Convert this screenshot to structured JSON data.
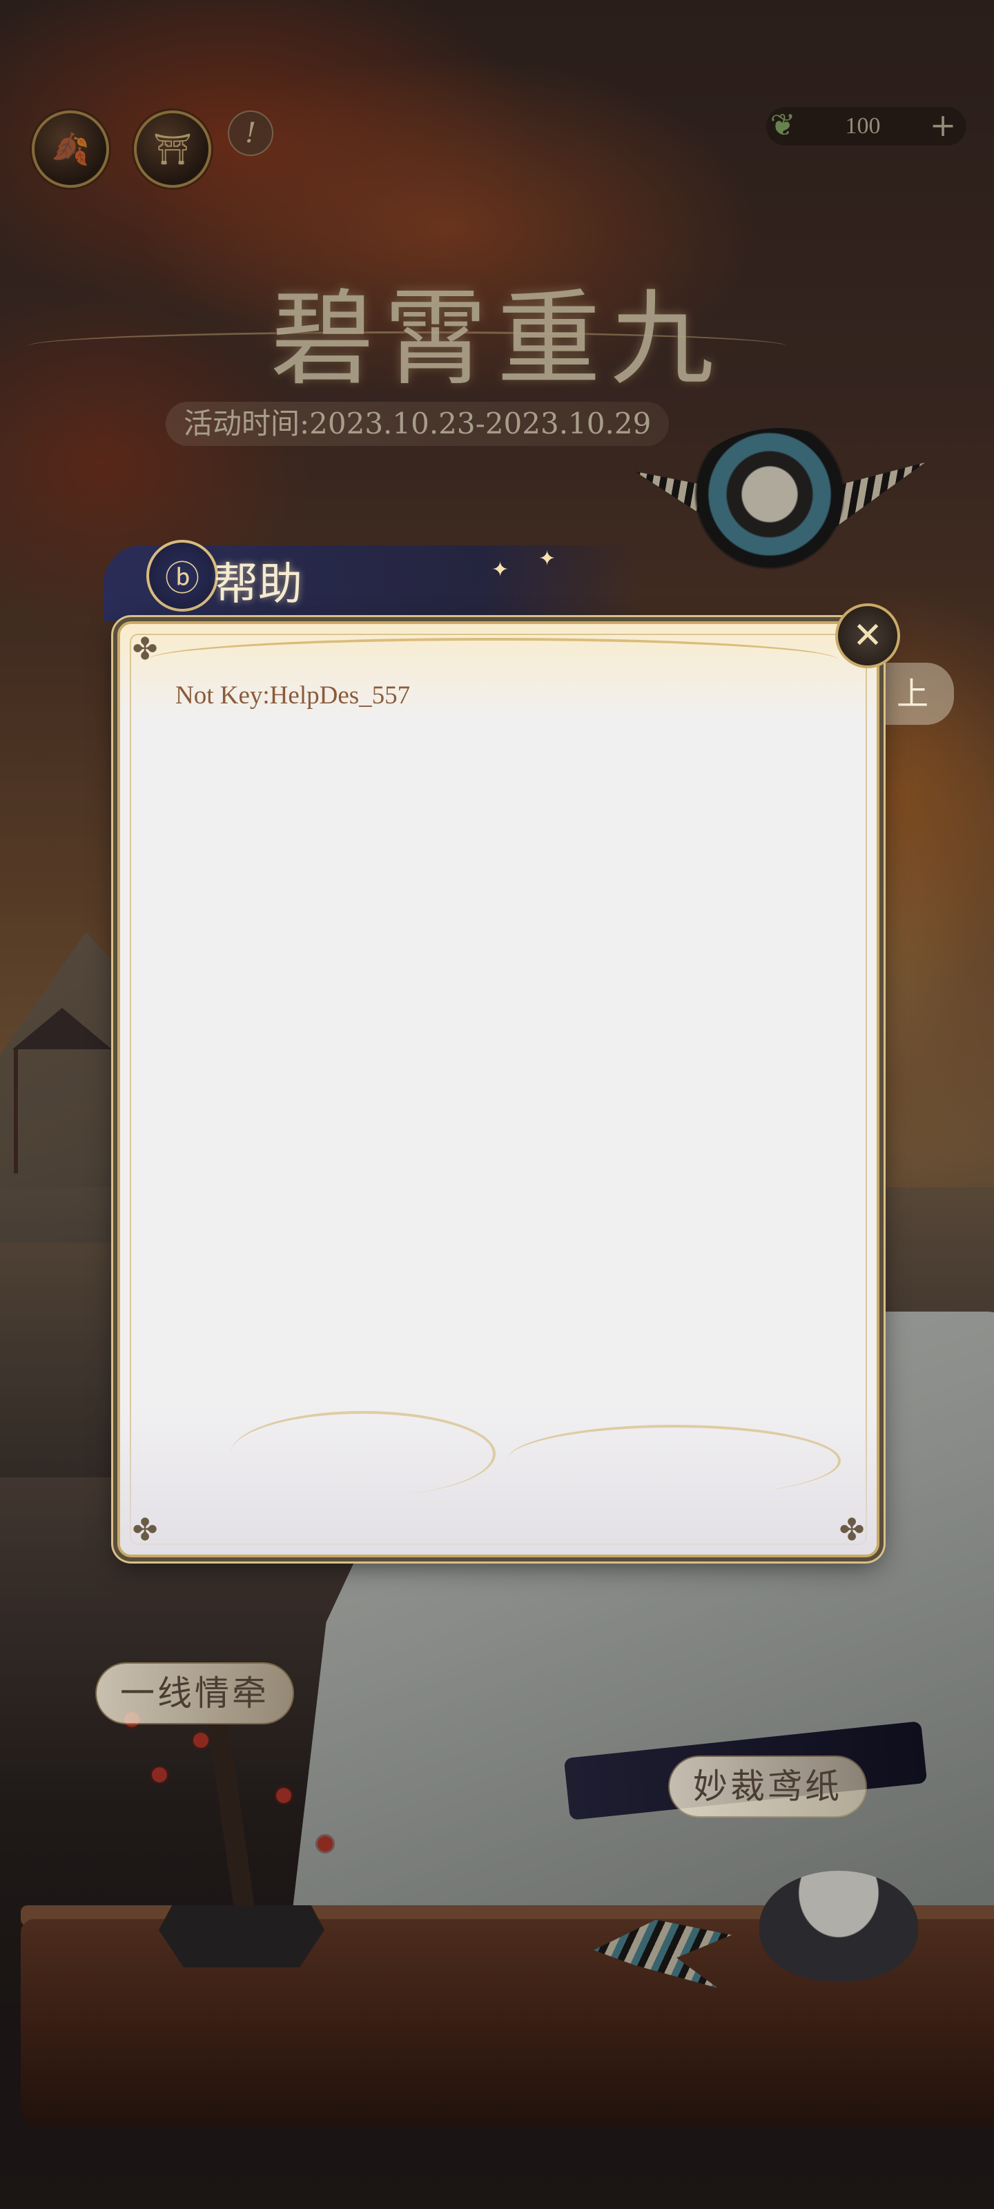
{
  "hud": {
    "icons": [
      "maple-leaf-icon",
      "pavilion-icon",
      "info-icon"
    ],
    "info_glyph": "!",
    "currency": {
      "icon": "leaf-currency-icon",
      "value": "100",
      "plus": "+"
    }
  },
  "event": {
    "title": "碧霄重九",
    "time": "活动时间:2023.10.23-2023.10.29"
  },
  "help_panel": {
    "tab_title": "帮助",
    "content": "Not Key:HelpDes_557",
    "close_glyph": "✕",
    "peek_right_text": "上"
  },
  "banners": {
    "left": "一线情牵",
    "right": "妙裁鸢纸"
  },
  "colors": {
    "dialog_bg": "#f1f0f1",
    "gold_border": "#c9aa68",
    "text_brown": "#8a5b3a",
    "tab_navy": "#282d5a"
  }
}
